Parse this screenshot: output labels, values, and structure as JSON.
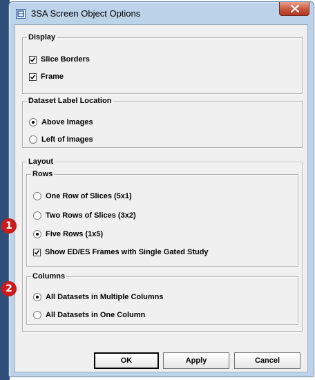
{
  "window": {
    "title": "3SA Screen Object Options"
  },
  "display": {
    "label": "Display",
    "slice_borders": "Slice Borders",
    "frame": "Frame"
  },
  "dataset_label": {
    "label": "Dataset Label Location",
    "above": "Above Images",
    "left": "Left of Images"
  },
  "layout": {
    "label": "Layout",
    "rows": {
      "label": "Rows",
      "one_row": "One Row of Slices (5x1)",
      "two_rows": "Two Rows of Slices (3x2)",
      "five_rows": "Five Rows (1x5)",
      "show_ed_es": "Show ED/ES Frames with Single Gated Study"
    },
    "columns": {
      "label": "Columns",
      "multiple": "All Datasets in Multiple Columns",
      "one": "All Datasets in One Column"
    }
  },
  "buttons": {
    "ok": "OK",
    "apply": "Apply",
    "cancel": "Cancel"
  },
  "annotations": {
    "badge1": "1",
    "badge2": "2"
  },
  "colors": {
    "badge": "#cc1b1b",
    "title_bar": "#bcd3ea",
    "close_button": "#c7553d"
  }
}
